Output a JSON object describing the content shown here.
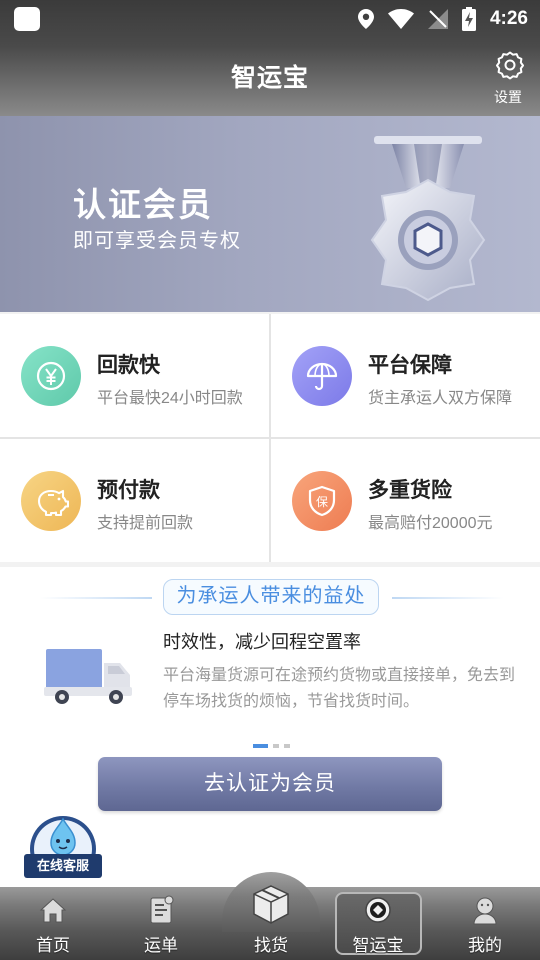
{
  "status": {
    "time": "4:26"
  },
  "header": {
    "title": "智运宝",
    "settings_label": "设置"
  },
  "banner": {
    "title": "认证会员",
    "subtitle": "即可享受会员专权"
  },
  "features": [
    {
      "title": "回款快",
      "desc": "平台最快24小时回款",
      "icon": "yen-icon",
      "color": "#6fd6b8"
    },
    {
      "title": "平台保障",
      "desc": "货主承运人双方保障",
      "icon": "umbrella-icon",
      "color": "#8d8cf0"
    },
    {
      "title": "预付款",
      "desc": "支持提前回款",
      "icon": "piggy-bank-icon",
      "color": "#f2c56d"
    },
    {
      "title": "多重货险",
      "desc": "最高赔付20000元",
      "icon": "insurance-icon",
      "color": "#f39065"
    }
  ],
  "benefits": {
    "section_title": "为承运人带来的益处",
    "heading": "时效性，减少回程空置率",
    "description": "平台海量货源可在途预约货物或直接接单，免去到停车场找货的烦恼，节省找货时间。",
    "cta_label": "去认证为会员",
    "service_label": "在线客服"
  },
  "nav": {
    "items": [
      {
        "label": "首页",
        "icon": "home-icon"
      },
      {
        "label": "运单",
        "icon": "waybill-icon"
      },
      {
        "label": "找货",
        "icon": "box-icon"
      },
      {
        "label": "智运宝",
        "icon": "coin-icon"
      },
      {
        "label": "我的",
        "icon": "user-icon"
      }
    ],
    "active": "智运宝"
  }
}
